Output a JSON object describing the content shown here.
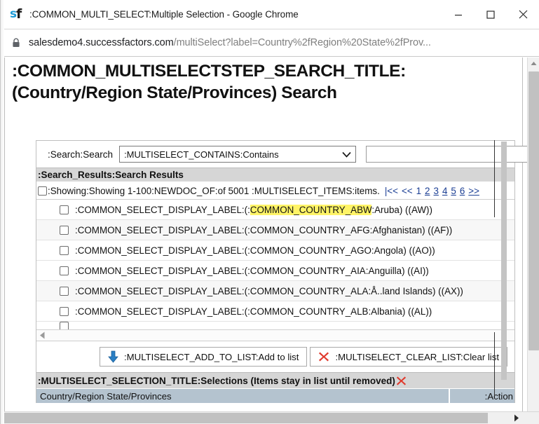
{
  "window": {
    "title": ":COMMON_MULTI_SELECT:Multiple Selection - Google Chrome",
    "favicon_s": "s",
    "favicon_f": "f",
    "minimize_label": "Minimize",
    "maximize_label": "Maximize",
    "close_label": "Close"
  },
  "address": {
    "domain": "salesdemo4.successfactors.com",
    "path": "/multiSelect?label=Country%2fRegion%20State%2fProv...",
    "lock_icon": "lock-icon"
  },
  "page": {
    "heading_line1": ":COMMON_MULTISELECTSTEP_SEARCH_TITLE:",
    "heading_line2": "(Country/Region State/Provinces) Search"
  },
  "search": {
    "label": ":Search:Search",
    "operator_selected": ":MULTISELECT_CONTAINS:Contains",
    "operator_options": [
      ":MULTISELECT_CONTAINS:Contains"
    ],
    "term_value": "",
    "term_placeholder": ""
  },
  "results": {
    "band_title": ":Search_Results:Search Results",
    "showing_text": ":Showing:Showing 1-100:NEWDOC_OF:of 5001 :MULTISELECT_ITEMS:items.",
    "pager": {
      "first": "|<<",
      "prev": "<<",
      "pages": [
        "1",
        "2",
        "3",
        "4",
        "5",
        "6"
      ],
      "current_page": "1",
      "next": ">>"
    },
    "rows": [
      {
        "label_prefix": ":COMMON_SELECT_DISPLAY_LABEL:(:",
        "label_highlight": "COMMON_COUNTRY_ABW",
        "label_suffix": ":Aruba) ((AW))"
      },
      {
        "label_prefix": ":COMMON_SELECT_DISPLAY_LABEL:(:",
        "label_highlight": "",
        "label_suffix": "COMMON_COUNTRY_AFG:Afghanistan) ((AF))"
      },
      {
        "label_prefix": ":COMMON_SELECT_DISPLAY_LABEL:(:",
        "label_highlight": "",
        "label_suffix": "COMMON_COUNTRY_AGO:Angola) ((AO))"
      },
      {
        "label_prefix": ":COMMON_SELECT_DISPLAY_LABEL:(:",
        "label_highlight": "",
        "label_suffix": "COMMON_COUNTRY_AIA:Anguilla) ((AI))"
      },
      {
        "label_prefix": ":COMMON_SELECT_DISPLAY_LABEL:(:",
        "label_highlight": "",
        "label_suffix": "COMMON_COUNTRY_ALA:Å..land Islands) ((AX))"
      },
      {
        "label_prefix": ":COMMON_SELECT_DISPLAY_LABEL:(:",
        "label_highlight": "",
        "label_suffix": "COMMON_COUNTRY_ALB:Albania) ((AL))"
      }
    ]
  },
  "actions": {
    "add_to_list": ":MULTISELECT_ADD_TO_LIST:Add to list",
    "add_icon": "down-arrow-icon",
    "clear_list": ":MULTISELECT_CLEAR_LIST:Clear list",
    "clear_icon": "red-x-icon"
  },
  "selection": {
    "title": ":MULTISELECT_SELECTION_TITLE:Selections (Items stay in list until removed)",
    "title_icon": "red-x-icon",
    "columns": [
      "Country/Region State/Provinces",
      ":Action"
    ]
  },
  "colors": {
    "highlight": "#fff467",
    "band": "#d6d6d6",
    "table_header": "#b4c3cf",
    "link": "#1c3f94",
    "accent_blue": "#1b9ad6",
    "accent_red": "#e0392c"
  }
}
